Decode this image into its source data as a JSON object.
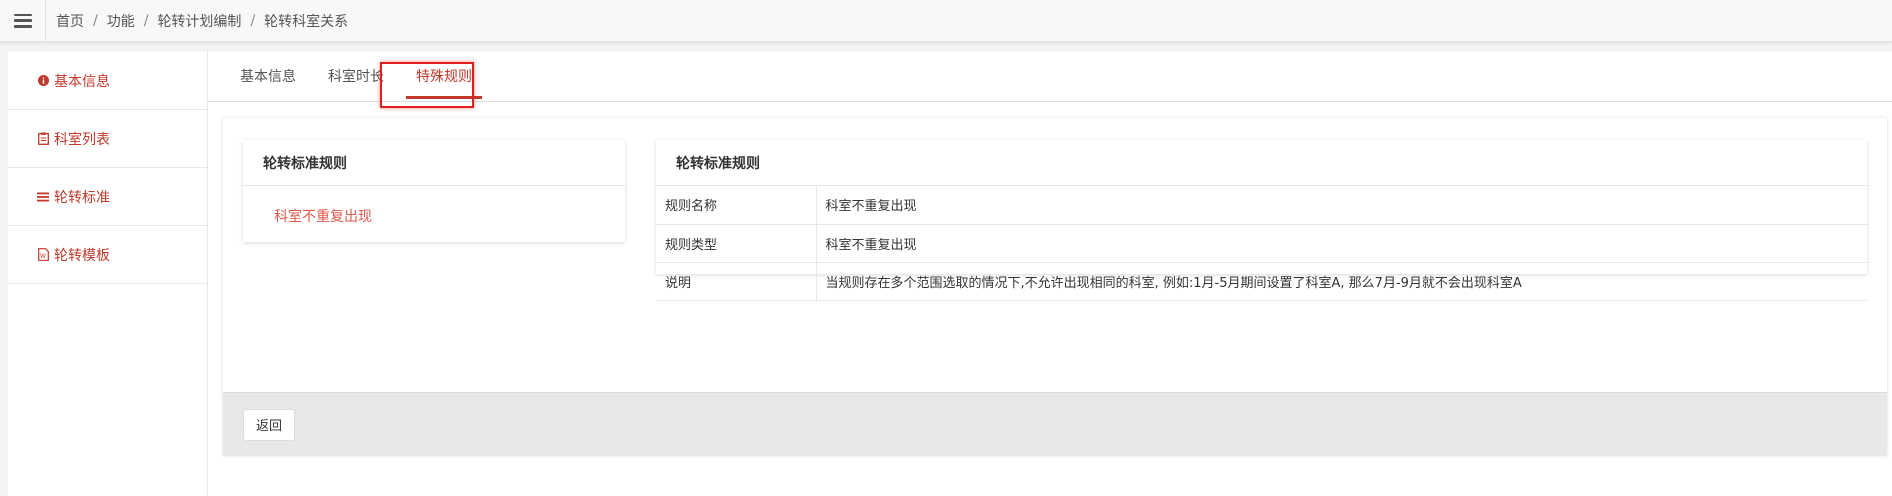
{
  "breadcrumb": [
    "首页",
    "功能",
    "轮转计划编制",
    "轮转科室关系"
  ],
  "sidebar": {
    "items": [
      {
        "label": "基本信息",
        "icon": "info-circle-icon"
      },
      {
        "label": "科室列表",
        "icon": "clipboard-icon"
      },
      {
        "label": "轮转标准",
        "icon": "list-icon"
      },
      {
        "label": "轮转模板",
        "icon": "document-icon"
      }
    ]
  },
  "tabs": [
    {
      "label": "基本信息"
    },
    {
      "label": "科室时长"
    },
    {
      "label": "特殊规则",
      "active": true
    }
  ],
  "left_card": {
    "title": "轮转标准规则",
    "rule": "科室不重复出现"
  },
  "right_card": {
    "title": "轮转标准规则",
    "rows": [
      {
        "key": "规则名称",
        "value": "科室不重复出现"
      },
      {
        "key": "规则类型",
        "value": "科室不重复出现"
      },
      {
        "key": "说明",
        "value": "当规则存在多个范围选取的情况下,不允许出现相同的科室, 例如:1月-5月期间设置了科室A, 那么7月-9月就不会出现科室A"
      }
    ]
  },
  "footer": {
    "back_label": "返回"
  },
  "colors": {
    "accent": "#c0392b",
    "link": "#e05a4e",
    "highlight": "#e02020"
  }
}
